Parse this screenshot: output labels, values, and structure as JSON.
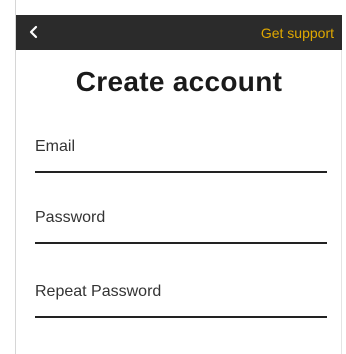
{
  "header": {
    "back_icon": "chevron-left-icon",
    "support_label": "Get support",
    "background_color": "#2b2b2b",
    "accent_color": "#e0a800"
  },
  "title": "Create account",
  "form": {
    "email_label": "Email",
    "password_label": "Password",
    "repeat_password_label": "Repeat Password"
  }
}
